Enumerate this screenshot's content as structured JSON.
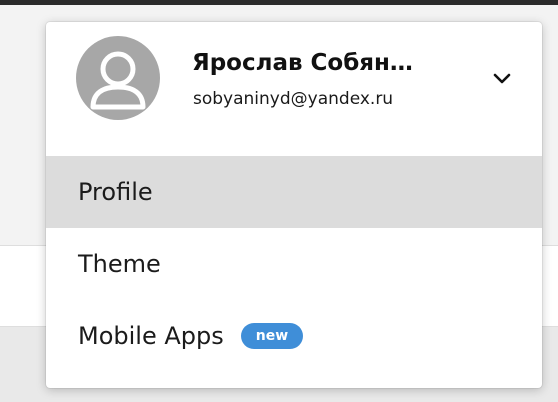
{
  "account": {
    "name": "Ярослав Собян…",
    "email": "sobyaninyd@yandex.ru",
    "avatar_icon": "user-avatar-icon",
    "toggle_icon": "chevron-down-icon"
  },
  "menu": {
    "items": [
      {
        "label": "Profile",
        "active": true
      },
      {
        "label": "Theme",
        "active": false
      },
      {
        "label": "Mobile Apps",
        "active": false,
        "badge": "new"
      }
    ]
  },
  "colors": {
    "badge_background": "#3f8ed8",
    "active_item_background": "#dcdcdc",
    "avatar_background": "#a7a7a7"
  }
}
